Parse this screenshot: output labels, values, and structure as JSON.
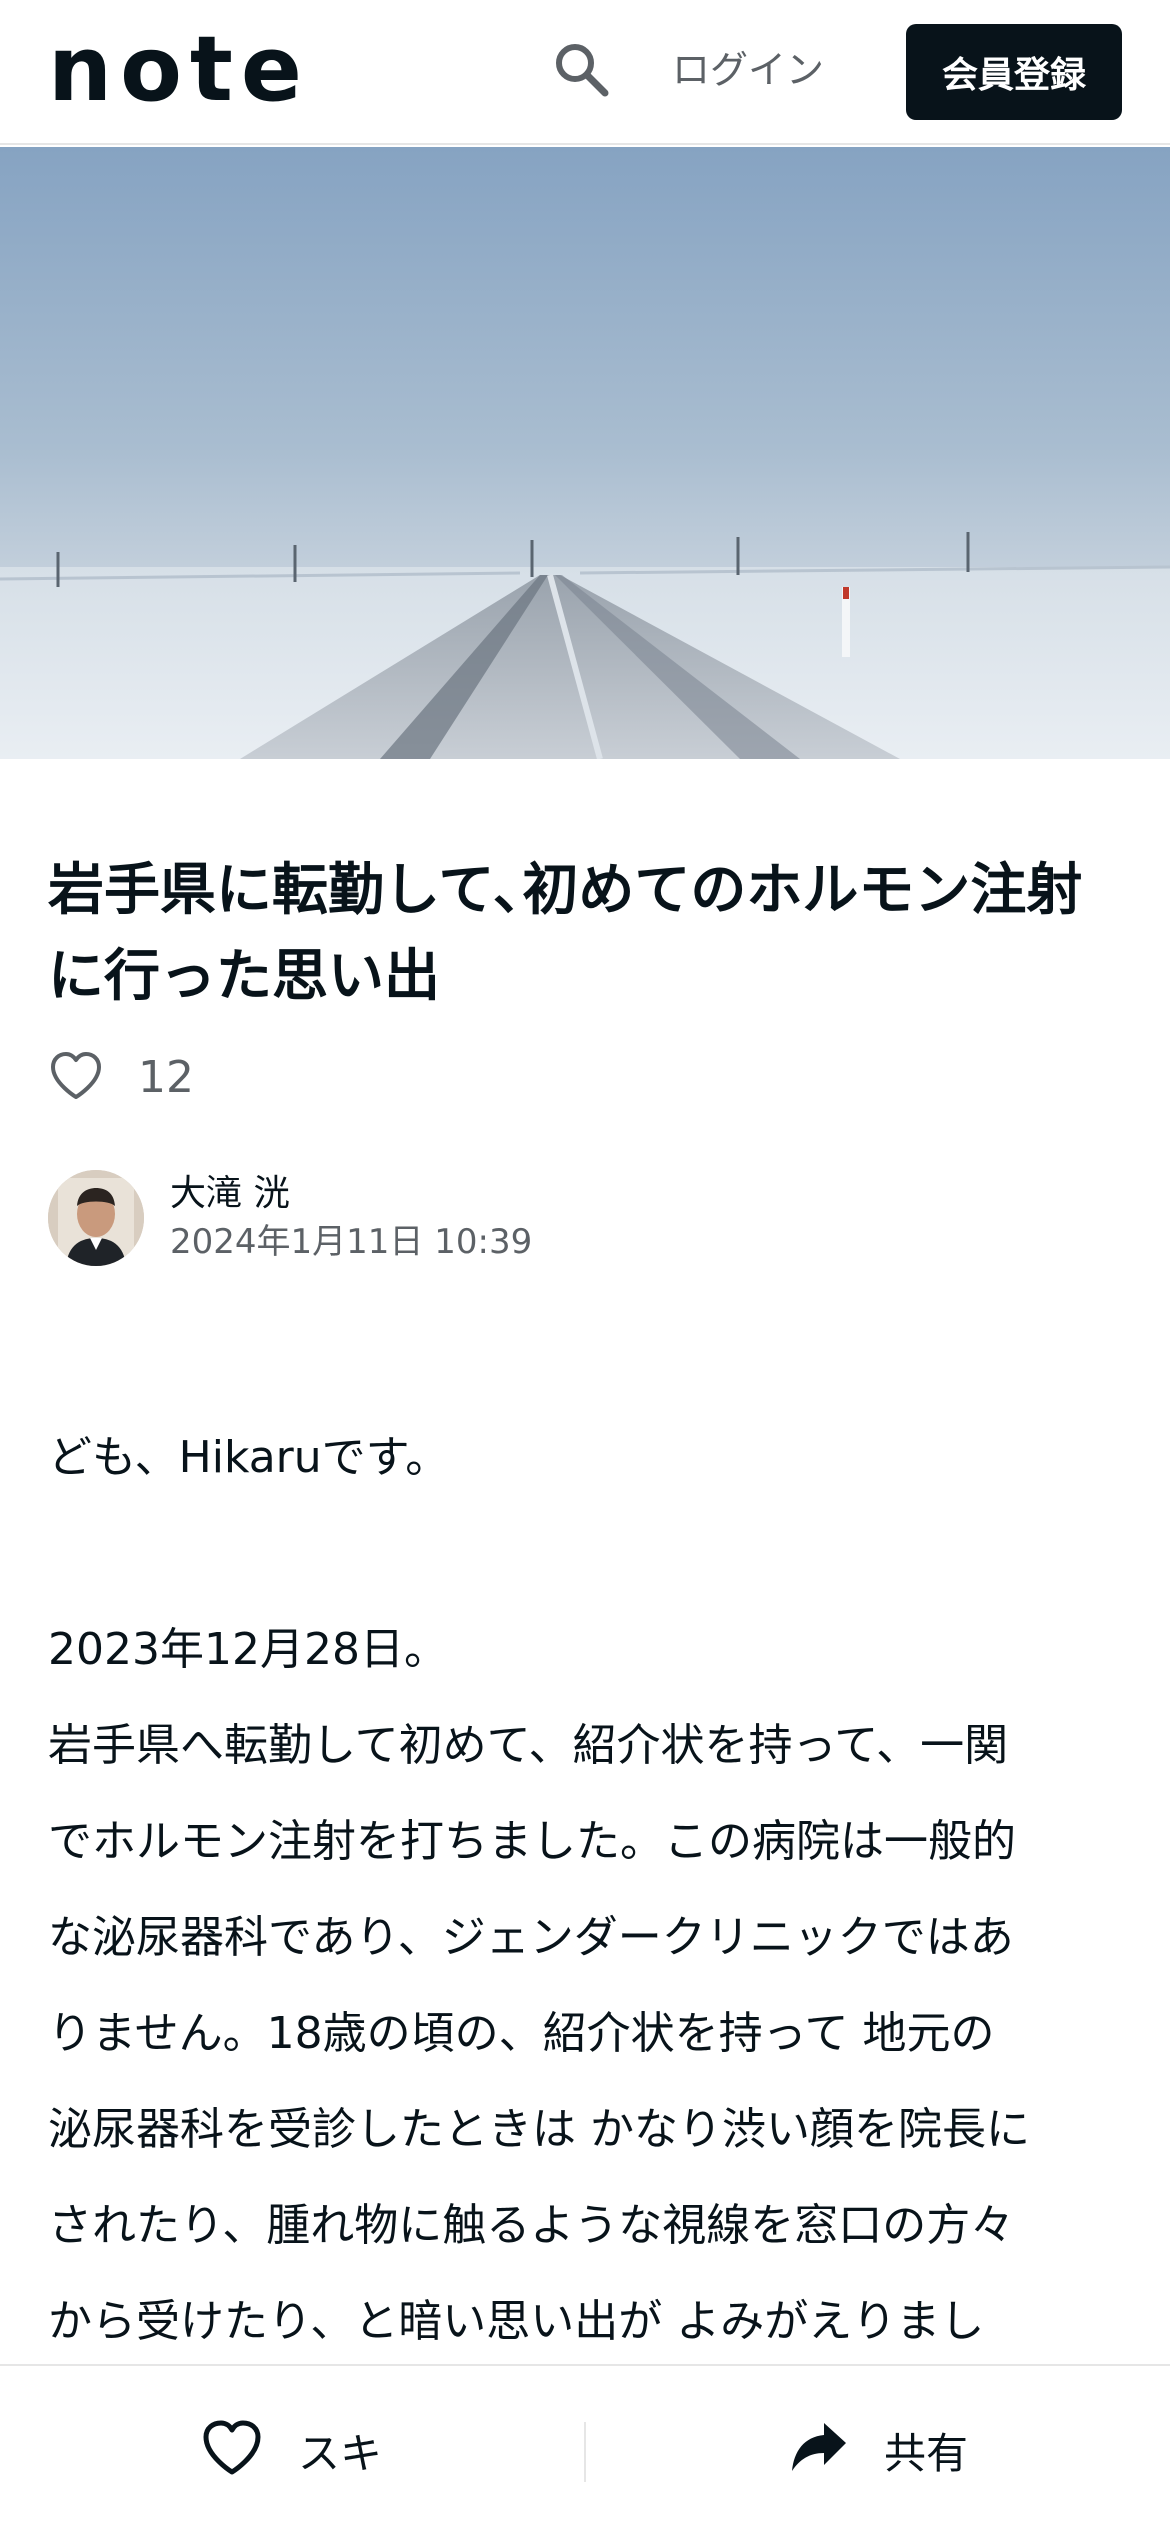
{
  "header": {
    "logo": "note",
    "login_label": "ログイン",
    "signup_label": "会員登録"
  },
  "article": {
    "title": "岩手県に転勤して､初めてのホルモン注射に行った思い出",
    "likes": "12",
    "author": {
      "name": "大滝 洸",
      "date": "2024年1月11日 10:39"
    },
    "body": {
      "greeting": "ども、Hikaruです。",
      "date_line": "2023年12月28日。",
      "lines": [
        "岩手県へ転勤して初めて、紹介状を持って、一関",
        "でホルモン注射を打ちました。この病院は一般的",
        "な泌尿器科であり、ジェンダークリニックではあ",
        "りません。18歳の頃の、紹介状を持って 地元の",
        "泌尿器科を受診したときは かなり渋い顔を院長に",
        "されたり、腫れ物に触るような視線を窓口の方々",
        "から受けたり、と暗い思い出が よみがえりまし"
      ]
    }
  },
  "bottom_bar": {
    "like_label": "スキ",
    "share_label": "共有"
  },
  "colors": {
    "text": "#08131a",
    "muted": "#5c6166",
    "button_bg": "#08131a",
    "divider": "#e6e6e6"
  },
  "icons": {
    "search": "search-icon",
    "heart": "heart-icon",
    "share": "share-arrow-icon"
  }
}
